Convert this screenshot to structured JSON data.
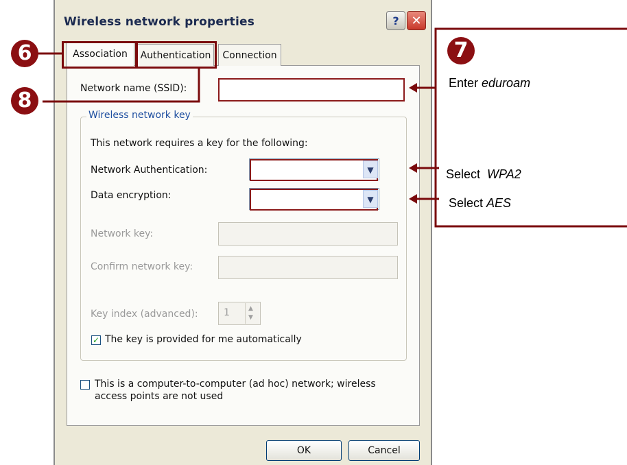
{
  "window": {
    "title": "Wireless network properties",
    "help_label": "?",
    "close_label": "✕"
  },
  "tabs": [
    {
      "label": "Association",
      "active": true
    },
    {
      "label": "Authentication",
      "active": false
    },
    {
      "label": "Connection",
      "active": false
    }
  ],
  "association": {
    "ssid_label": "Network name (SSID):",
    "ssid_value": "",
    "group_title": "Wireless network key",
    "requires_text": "This network requires a key for the following:",
    "net_auth_label": "Network Authentication:",
    "net_auth_value": "",
    "data_enc_label": "Data encryption:",
    "data_enc_value": "",
    "network_key_label": "Network key:",
    "confirm_key_label": "Confirm network key:",
    "key_index_label": "Key index (advanced):",
    "key_index_value": "1",
    "auto_key_label": "The key is provided for me automatically",
    "auto_key_checked": true,
    "adhoc_label_line1": "This is a computer-to-computer (ad hoc) network; wireless",
    "adhoc_label_line2": "access points are not used",
    "adhoc_checked": false
  },
  "buttons": {
    "ok": "OK",
    "cancel": "Cancel"
  },
  "annotations": {
    "step6": "6",
    "step7": "7",
    "step8": "8",
    "ssid_prefix": "Enter ",
    "ssid_value": "eduroam",
    "auth_prefix": "Select  ",
    "auth_value": "WPA2",
    "enc_prefix": "Select ",
    "enc_value": "AES"
  },
  "colors": {
    "annotation": "#8b0f12",
    "dialog_bg": "#ece9d8"
  }
}
